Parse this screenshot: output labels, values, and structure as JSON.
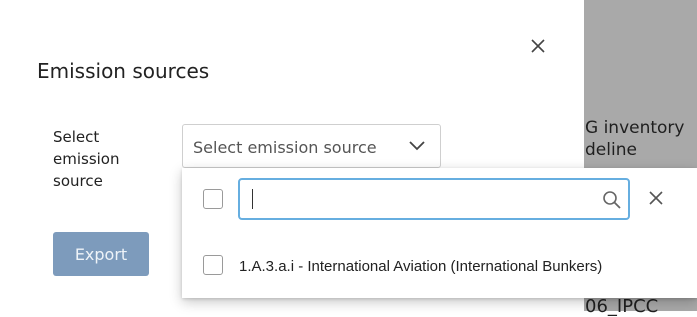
{
  "background": {
    "line1": "G inventory",
    "line2": "deline",
    "line3": "06_IPCC"
  },
  "modal": {
    "title": "Emission sources",
    "field_label": "Select emission source",
    "select_placeholder": "Select emission source",
    "export_label": "Export"
  },
  "dropdown": {
    "search_value": "",
    "options": [
      {
        "label": "1.A.3.a.i - International Aviation (International Bunkers)",
        "checked": false
      }
    ]
  },
  "colors": {
    "backdrop": "#a9a9a9",
    "export_button": "#7d9bbc",
    "search_focus_border": "#66aee0"
  },
  "icons": [
    "close-icon",
    "chevron-down-icon",
    "search-icon",
    "clear-icon"
  ]
}
